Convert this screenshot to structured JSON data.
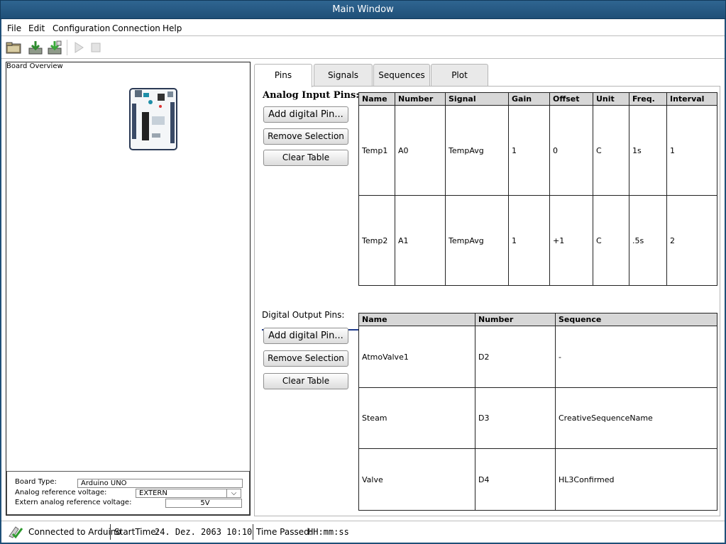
{
  "window": {
    "title": "Main Window"
  },
  "menu": {
    "items": [
      "File",
      "Edit",
      "Configuration",
      "Connection",
      "Help"
    ]
  },
  "toolbar": {
    "icons": [
      "open-folder-icon",
      "download-icon",
      "download-alt-icon",
      "play-icon",
      "stop-icon"
    ]
  },
  "board": {
    "title": "Board Overview",
    "props": {
      "type_label": "Board Type:",
      "type_value": "Arduino UNO",
      "analog_ref_label": "Analog reference voltage:",
      "analog_ref_value": "EXTERN",
      "extern_ref_label": "Extern analog reference voltage:",
      "extern_ref_value": "5V"
    }
  },
  "tabs": [
    "Pins",
    "Signals",
    "Sequences",
    "Plot"
  ],
  "analog": {
    "label": "Analog Input Pins:",
    "buttons": {
      "add": "Add digital Pin...",
      "remove": "Remove Selection",
      "clear": "Clear Table"
    },
    "columns": [
      "Name",
      "Number",
      "Signal",
      "Gain",
      "Offset",
      "Unit",
      "Freq.",
      "Interval"
    ],
    "rows": [
      [
        "Temp1",
        "A0",
        "TempAvg",
        "1",
        "0",
        "C",
        "1s",
        "1"
      ],
      [
        "Temp2",
        "A1",
        "TempAvg",
        "1",
        "+1",
        "C",
        ".5s",
        "2"
      ]
    ]
  },
  "digital": {
    "label": "Digital Output Pins:",
    "buttons": {
      "add": "Add digital Pin...",
      "remove": "Remove Selection",
      "clear": "Clear Table"
    },
    "columns": [
      "Name",
      "Number",
      "Sequence"
    ],
    "rows": [
      [
        "AtmoValve1",
        "D2",
        "-"
      ],
      [
        "Steam",
        "D3",
        "CreativeSequenceName"
      ],
      [
        "Valve",
        "D4",
        "HL3Confirmed"
      ]
    ]
  },
  "status": {
    "connection": "Connected to Arduino",
    "start_label": "StartTime:",
    "start_value": "24. Dez. 2063 10:10",
    "passed_label": "Time Passed:",
    "passed_value": "HH:mm:ss"
  },
  "colors": {
    "titlebar": "#1f4f78",
    "divider": "#1e3b8c",
    "header": "#d7d7d7"
  }
}
